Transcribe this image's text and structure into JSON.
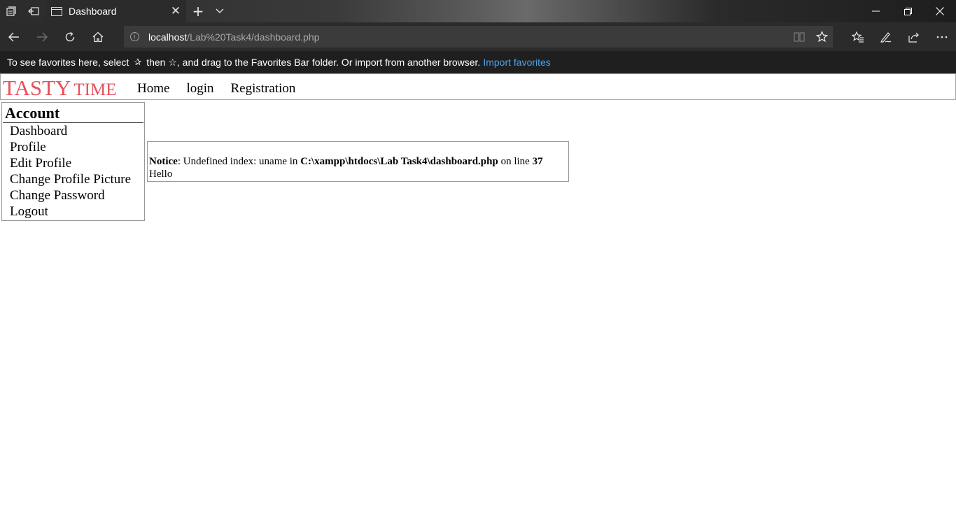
{
  "browser": {
    "tab_title": "Dashboard",
    "tab_close_glyph": "✕",
    "new_tab_glyph": "+",
    "tab_list_glyph": "⌄",
    "address": {
      "host": "localhost",
      "path": "/Lab%20Task4/dashboard.php"
    },
    "favorites_bar": {
      "message_part1": "To see favorites here, select",
      "message_part2": "then ☆, and drag to the Favorites Bar folder. Or import from another browser.",
      "import_link": "Import favorites"
    },
    "icons": {
      "tab_actions": "tab-actions-icon",
      "set_aside": "set-aside-tabs-icon",
      "back": "back-arrow-icon",
      "forward": "forward-arrow-icon",
      "refresh": "refresh-icon",
      "home": "home-icon",
      "reading_view": "reading-view-icon",
      "favorite_star": "star-icon",
      "favorites_hub": "favorites-hub-icon",
      "notes": "web-note-pen-icon",
      "share": "share-icon",
      "more": "more-ellipsis-icon"
    }
  },
  "site": {
    "logo_big": "TASTY",
    "logo_small": "TIME",
    "logo_color": "#e8505b",
    "menu": [
      "Home",
      "login",
      "Registration"
    ]
  },
  "sidebar": {
    "title": "Account",
    "items": [
      "Dashboard",
      "Profile",
      "Edit Profile",
      "Change Profile Picture",
      "Change Password",
      "Logout"
    ]
  },
  "notice": {
    "label": "Notice",
    "text1": ": Undefined index: uname in ",
    "path": "C:\\xampp\\htdocs\\Lab Task4\\dashboard.php",
    "text2": " on line ",
    "line": "37",
    "greeting": "Hello"
  }
}
